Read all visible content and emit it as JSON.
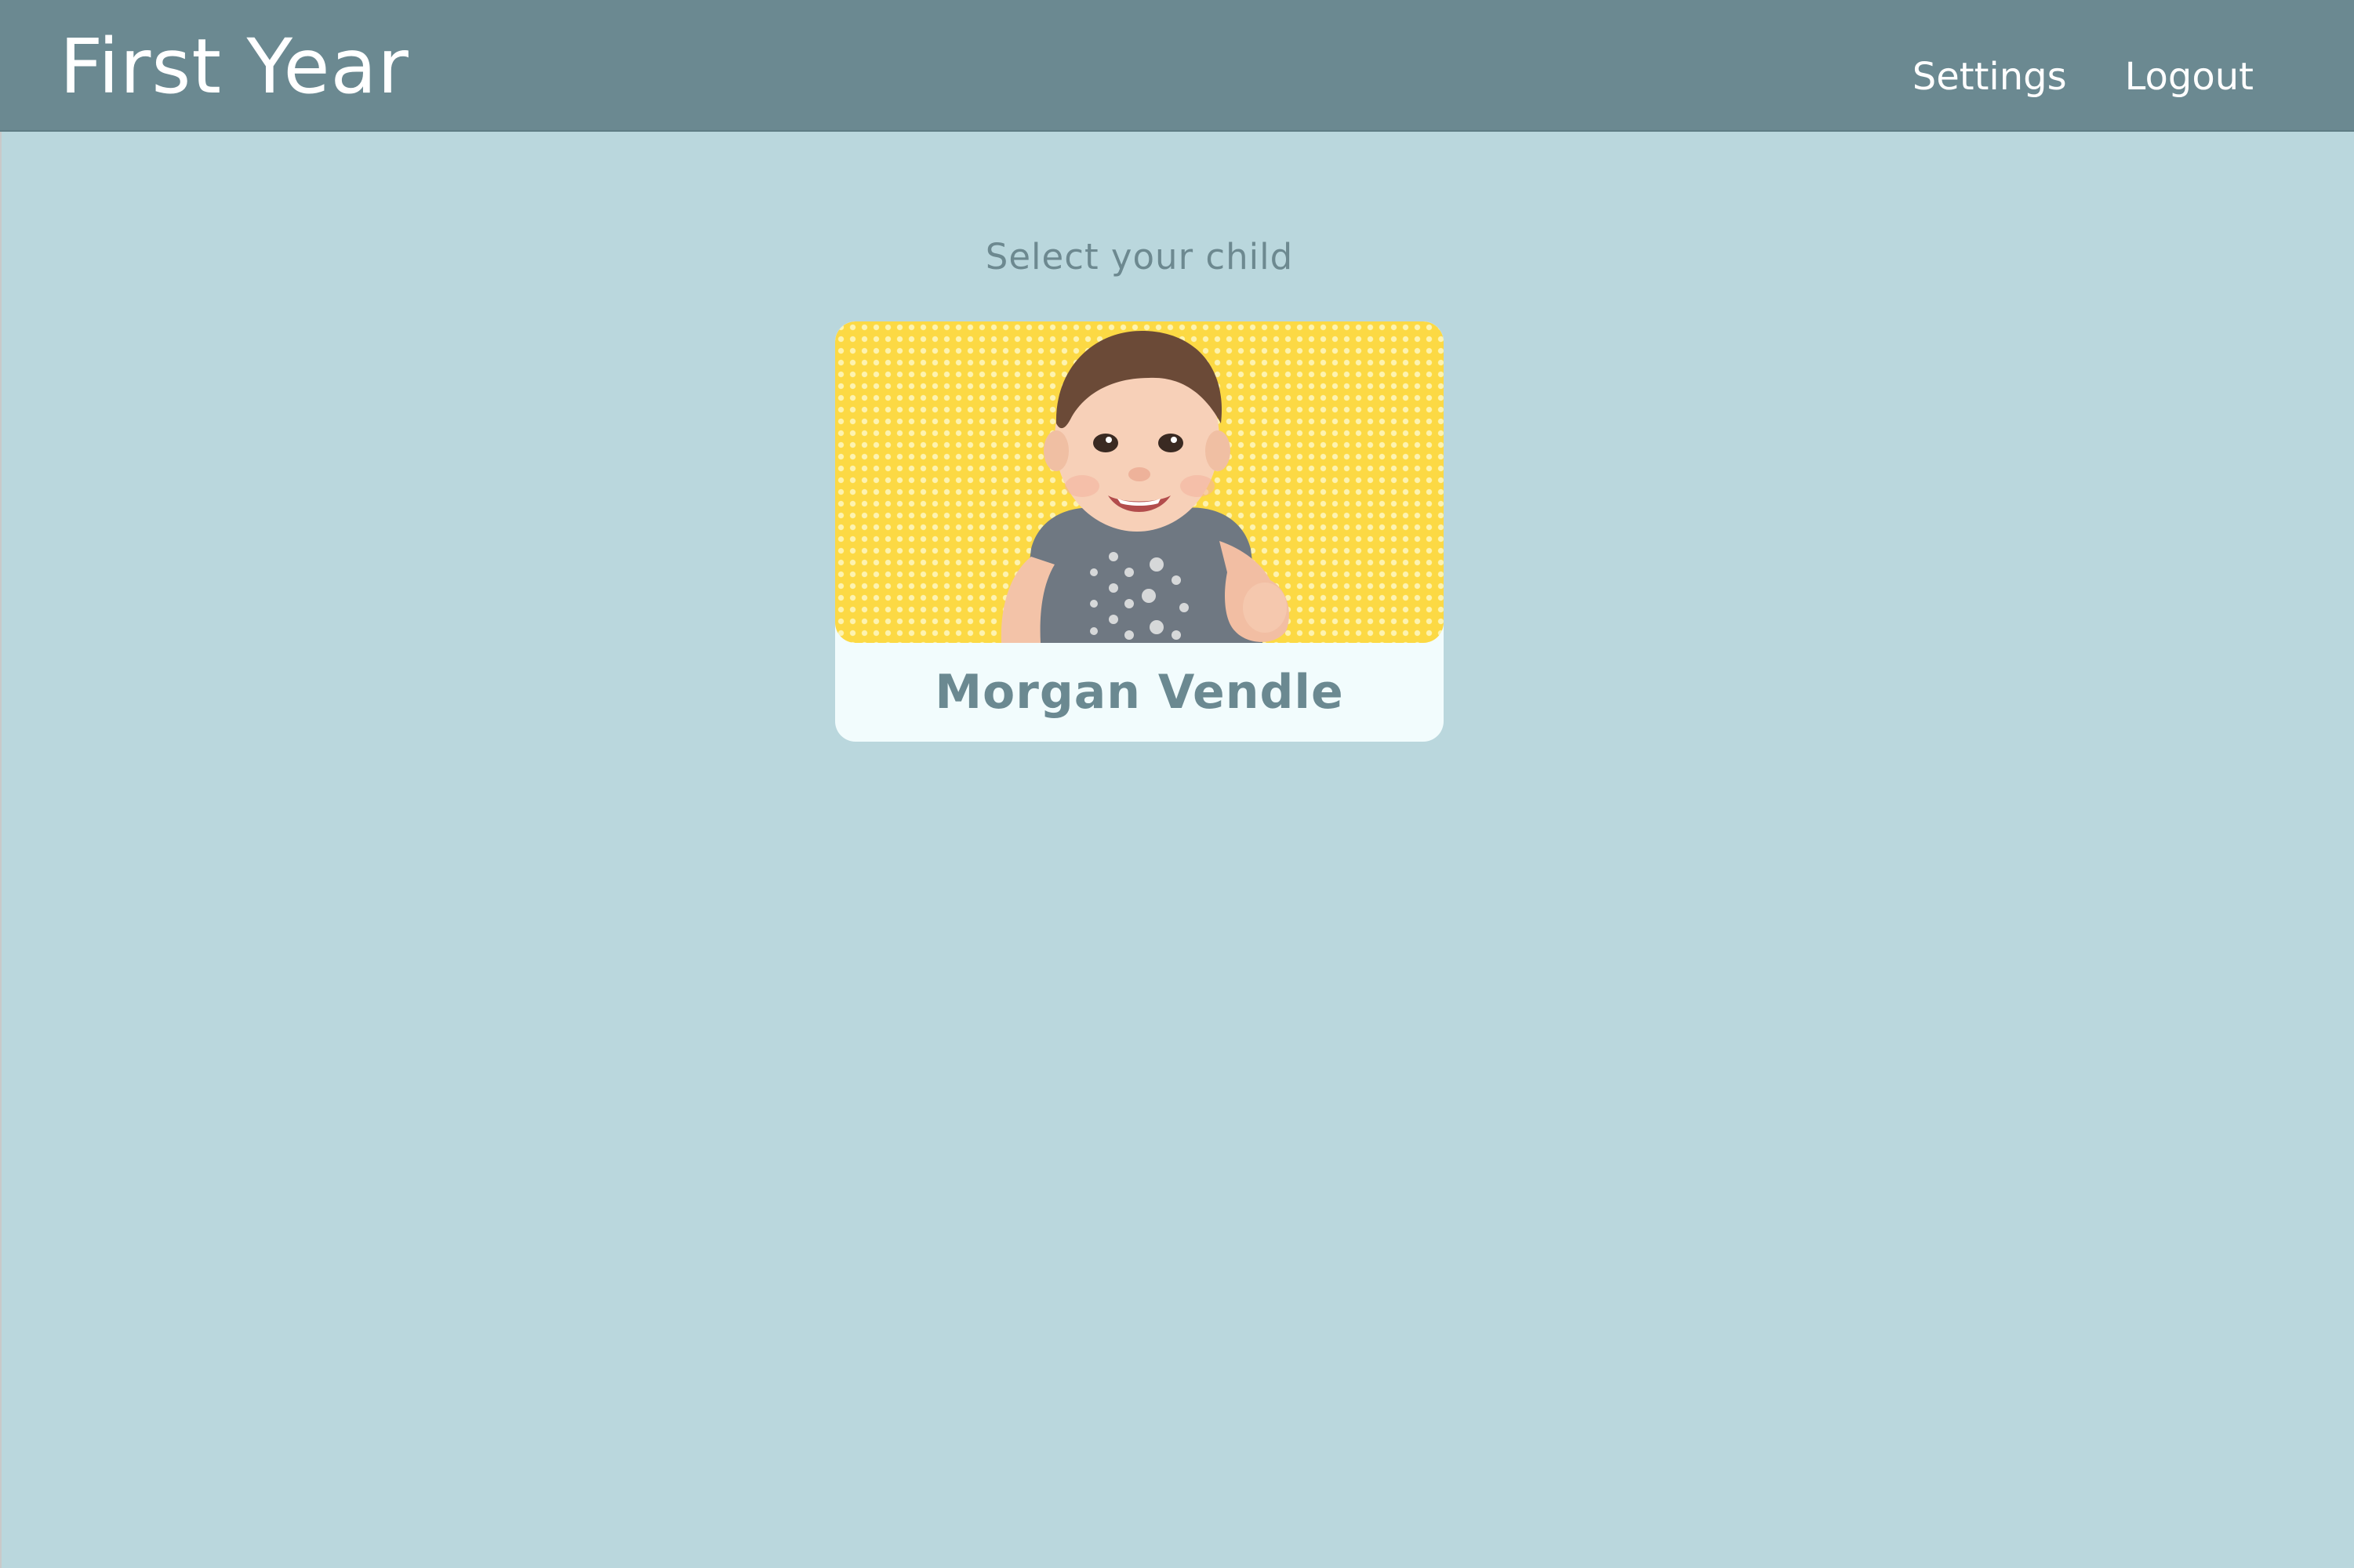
{
  "header": {
    "title": "First Year",
    "nav": {
      "settings_label": "Settings",
      "logout_label": "Logout"
    }
  },
  "main": {
    "prompt": "Select your child",
    "children": [
      {
        "name": "Morgan Vendle",
        "photo_icon": "child-photo"
      }
    ]
  },
  "colors": {
    "header_bg": "#6b8991",
    "page_bg": "#bad7dd",
    "card_bg": "#f2fcfd",
    "text_accent": "#6b8991",
    "photo_bg": "#fcd944"
  }
}
